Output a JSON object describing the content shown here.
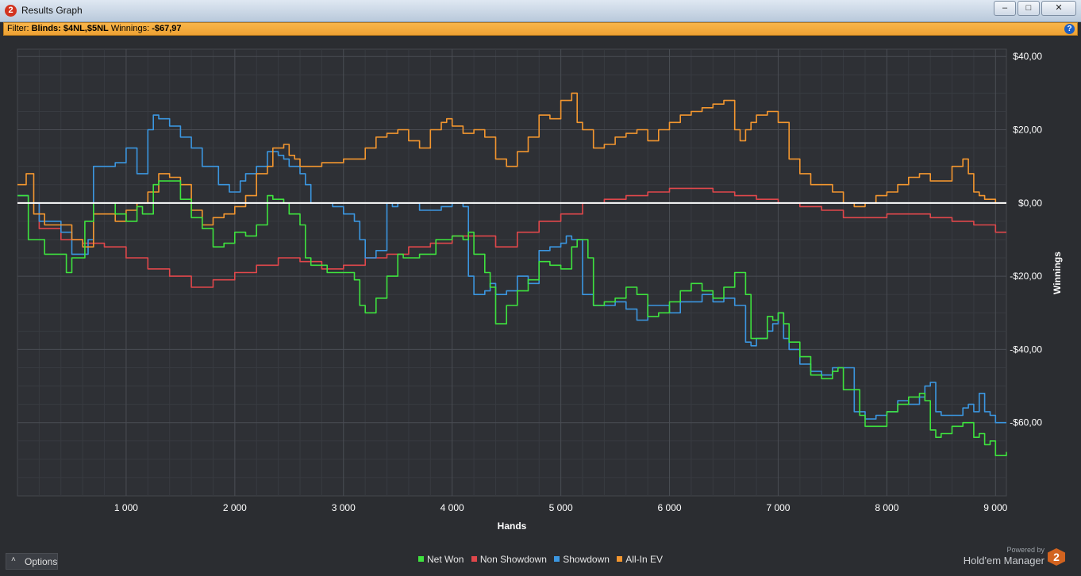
{
  "window": {
    "title": "Results Graph",
    "icon": "hm2-app-icon",
    "controls": [
      "minimize-icon",
      "maximize-icon",
      "close-icon"
    ]
  },
  "filter": {
    "prefix": "Filter:",
    "blinds_label": "Blinds:",
    "blinds_value": "$4NL,$5NL",
    "winnings_label": "Winnings:",
    "winnings_value": "-$67,97"
  },
  "options_label": "Options",
  "brand": {
    "powered_by": "Powered by",
    "name": "Hold'em Manager",
    "logo": "2"
  },
  "colors": {
    "net_won": "#3ee23e",
    "non_showdown": "#e0474b",
    "showdown": "#3b96e0",
    "all_in_ev": "#f3962f",
    "zero_line": "#ffffff"
  },
  "chart_data": {
    "type": "line",
    "xlabel": "Hands",
    "ylabel": "Winnings",
    "xlim": [
      0,
      9100
    ],
    "ylim": [
      -80,
      42
    ],
    "x_ticks": [
      1000,
      2000,
      3000,
      4000,
      5000,
      6000,
      7000,
      8000,
      9000
    ],
    "x_tick_labels": [
      "1 000",
      "2 000",
      "3 000",
      "4 000",
      "5 000",
      "6 000",
      "7 000",
      "8 000",
      "9 000"
    ],
    "y_ticks": [
      40,
      20,
      0,
      -20,
      -40,
      -60
    ],
    "y_tick_labels": [
      "$40,00",
      "$20,00",
      "$0,00",
      "-$20,00",
      "-$40,00",
      "-$60,00"
    ],
    "grid": true,
    "legend_position": "bottom-center",
    "series": [
      {
        "name": "Net Won",
        "color": "#3ee23e",
        "x": [
          0,
          100,
          250,
          450,
          500,
          620,
          700,
          900,
          1000,
          1100,
          1150,
          1250,
          1300,
          1500,
          1600,
          1700,
          1800,
          1900,
          2000,
          2100,
          2200,
          2300,
          2350,
          2450,
          2500,
          2600,
          2650,
          2700,
          2850,
          3000,
          3100,
          3150,
          3200,
          3300,
          3400,
          3500,
          3550,
          3700,
          3850,
          4000,
          4100,
          4150,
          4200,
          4300,
          4350,
          4400,
          4500,
          4600,
          4700,
          4800,
          4900,
          5000,
          5100,
          5150,
          5200,
          5250,
          5300,
          5400,
          5500,
          5600,
          5700,
          5800,
          5900,
          6000,
          6100,
          6200,
          6300,
          6400,
          6500,
          6600,
          6650,
          6700,
          6750,
          6800,
          6900,
          6950,
          7000,
          7050,
          7100,
          7200,
          7300,
          7400,
          7500,
          7550,
          7600,
          7700,
          7750,
          7800,
          7850,
          7900,
          8000,
          8100,
          8150,
          8200,
          8300,
          8350,
          8400,
          8450,
          8500,
          8600,
          8700,
          8750,
          8800,
          8850,
          8900,
          8950,
          9000,
          9100
        ],
        "y": [
          2,
          -10,
          -14,
          -19,
          -15,
          -5,
          0,
          -3,
          -5,
          -1,
          -3,
          5,
          6,
          1,
          -4,
          -7,
          -12,
          -11,
          -8,
          -9,
          -6,
          2,
          1,
          0,
          -3,
          -6,
          -15,
          -17,
          -19,
          -19,
          -21,
          -28,
          -30,
          -26,
          -20,
          -14,
          -15,
          -14,
          -10,
          -9,
          -10,
          -8,
          -14,
          -19,
          -23,
          -33,
          -28,
          -24,
          -21,
          -16,
          -17,
          -18,
          -12,
          -10,
          -10,
          -15,
          -28,
          -27,
          -26,
          -23,
          -25,
          -31,
          -30,
          -27,
          -24,
          -22,
          -24,
          -26,
          -23,
          -19,
          -19,
          -25,
          -37,
          -37,
          -31,
          -32,
          -30,
          -33,
          -38,
          -42,
          -47,
          -48,
          -46,
          -45,
          -51,
          -51,
          -58,
          -61,
          -61,
          -61,
          -57,
          -55,
          -55,
          -53,
          -52,
          -54,
          -62,
          -64,
          -63,
          -61,
          -60,
          -60,
          -64,
          -63,
          -66,
          -65,
          -69,
          -68
        ]
      },
      {
        "name": "Non Showdown",
        "color": "#e0474b",
        "x": [
          0,
          200,
          400,
          600,
          800,
          1000,
          1200,
          1400,
          1600,
          1800,
          2000,
          2200,
          2400,
          2600,
          2800,
          3000,
          3200,
          3400,
          3600,
          3800,
          4000,
          4200,
          4400,
          4600,
          4800,
          5000,
          5200,
          5400,
          5600,
          5800,
          6000,
          6200,
          6400,
          6600,
          6800,
          7000,
          7200,
          7400,
          7600,
          7800,
          8000,
          8200,
          8400,
          8600,
          8800,
          9000,
          9100
        ],
        "y": [
          0,
          -7,
          -10,
          -11,
          -12,
          -15,
          -18,
          -20,
          -23,
          -21,
          -19,
          -17,
          -15,
          -16,
          -18,
          -17,
          -15,
          -14,
          -12,
          -11,
          -9,
          -9,
          -12,
          -8,
          -5,
          -3,
          0,
          1,
          2,
          3,
          4,
          4,
          3,
          2,
          1,
          0,
          -1,
          -2,
          -4,
          -4,
          -3,
          -3,
          -4,
          -5,
          -6,
          -8,
          -8
        ]
      },
      {
        "name": "Showdown",
        "color": "#3b96e0",
        "x": [
          0,
          100,
          200,
          400,
          500,
          650,
          700,
          900,
          1000,
          1100,
          1200,
          1250,
          1300,
          1400,
          1500,
          1600,
          1700,
          1850,
          1950,
          2050,
          2100,
          2200,
          2300,
          2400,
          2450,
          2500,
          2600,
          2650,
          2700,
          2900,
          3000,
          3100,
          3150,
          3200,
          3300,
          3400,
          3450,
          3500,
          3700,
          3800,
          3900,
          4000,
          4100,
          4150,
          4200,
          4300,
          4350,
          4400,
          4500,
          4600,
          4700,
          4800,
          4900,
          5000,
          5050,
          5100,
          5200,
          5250,
          5300,
          5400,
          5500,
          5600,
          5700,
          5800,
          5900,
          6000,
          6100,
          6200,
          6300,
          6400,
          6500,
          6600,
          6650,
          6700,
          6750,
          6800,
          6900,
          6950,
          7000,
          7050,
          7100,
          7200,
          7300,
          7400,
          7500,
          7600,
          7700,
          7800,
          7900,
          8000,
          8100,
          8200,
          8300,
          8350,
          8400,
          8450,
          8500,
          8600,
          8700,
          8750,
          8800,
          8850,
          8900,
          8950,
          9000,
          9100
        ],
        "y": [
          2,
          0,
          -5,
          -8,
          -14,
          -10,
          10,
          11,
          15,
          8,
          20,
          24,
          23,
          21,
          18,
          15,
          10,
          5,
          3,
          6,
          8,
          10,
          14,
          13,
          12,
          10,
          8,
          5,
          0,
          -1,
          -3,
          -5,
          -10,
          -15,
          -13,
          0,
          -1,
          0,
          -2,
          -2,
          -1,
          0,
          -1,
          -20,
          -25,
          -24,
          -22,
          -25,
          -24,
          -20,
          -22,
          -13,
          -12,
          -11,
          -9,
          -10,
          -25,
          -25,
          -28,
          -28,
          -27,
          -29,
          -32,
          -28,
          -28,
          -30,
          -27,
          -27,
          -25,
          -27,
          -26,
          -28,
          -28,
          -38,
          -39,
          -37,
          -35,
          -33,
          -30,
          -37,
          -40,
          -44,
          -46,
          -47,
          -45,
          -45,
          -57,
          -59,
          -58,
          -57,
          -54,
          -55,
          -53,
          -50,
          -49,
          -57,
          -58,
          -58,
          -56,
          -55,
          -57,
          -52,
          -57,
          -58,
          -60,
          -60
        ]
      },
      {
        "name": "All-In EV",
        "color": "#f3962f",
        "x": [
          0,
          80,
          150,
          250,
          400,
          500,
          600,
          700,
          800,
          900,
          1000,
          1100,
          1200,
          1300,
          1400,
          1500,
          1600,
          1700,
          1800,
          1900,
          2000,
          2100,
          2200,
          2300,
          2350,
          2450,
          2500,
          2550,
          2600,
          2800,
          3000,
          3100,
          3200,
          3300,
          3400,
          3500,
          3600,
          3700,
          3800,
          3900,
          3950,
          4000,
          4100,
          4200,
          4300,
          4400,
          4500,
          4600,
          4700,
          4800,
          4850,
          4900,
          5000,
          5100,
          5150,
          5200,
          5300,
          5400,
          5500,
          5600,
          5700,
          5800,
          5900,
          6000,
          6100,
          6200,
          6300,
          6400,
          6500,
          6600,
          6650,
          6700,
          6750,
          6800,
          6900,
          7000,
          7100,
          7200,
          7300,
          7400,
          7500,
          7600,
          7650,
          7700,
          7800,
          7900,
          8000,
          8100,
          8200,
          8300,
          8400,
          8500,
          8600,
          8700,
          8750,
          8800,
          8850,
          8900,
          8950,
          9000,
          9100
        ],
        "y": [
          5,
          8,
          -3,
          -6,
          -6,
          -10,
          -12,
          -3,
          -3,
          -5,
          -2,
          0,
          3,
          8,
          7,
          5,
          -2,
          -6,
          -4,
          -3,
          -1,
          2,
          8,
          10,
          15,
          16,
          13,
          12,
          10,
          11,
          12,
          12,
          15,
          18,
          19,
          20,
          17,
          15,
          20,
          22,
          23,
          21,
          19,
          20,
          18,
          12,
          10,
          14,
          18,
          24,
          24,
          23,
          28,
          30,
          22,
          20,
          15,
          16,
          18,
          19,
          20,
          17,
          20,
          22,
          24,
          25,
          26,
          27,
          28,
          20,
          17,
          20,
          22,
          24,
          25,
          22,
          12,
          8,
          5,
          5,
          3,
          0,
          0,
          -1,
          0,
          2,
          3,
          5,
          7,
          8,
          6,
          6,
          10,
          12,
          8,
          3,
          2,
          1,
          1,
          0,
          0
        ]
      }
    ]
  }
}
